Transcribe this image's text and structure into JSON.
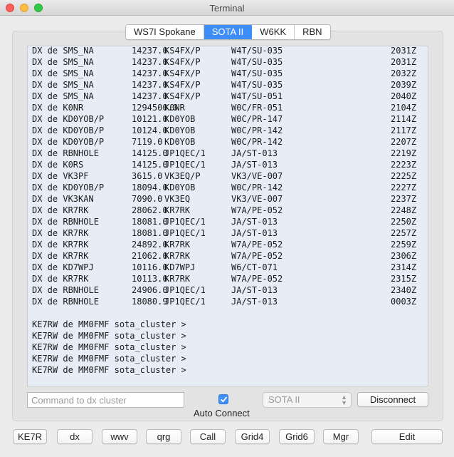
{
  "window": {
    "title": "Terminal"
  },
  "tabs": [
    {
      "label": "WS7I Spokane",
      "active": false
    },
    {
      "label": "SOTA II",
      "active": true
    },
    {
      "label": "W6KK",
      "active": false
    },
    {
      "label": "RBN",
      "active": false
    }
  ],
  "terminal": {
    "spots": [
      [
        "DX de SMS_NA",
        "14237.0",
        "KS4FX/P",
        "W4T/SU-035",
        "2031Z"
      ],
      [
        "DX de SMS_NA",
        "14237.0",
        "KS4FX/P",
        "W4T/SU-035",
        "2031Z"
      ],
      [
        "DX de SMS_NA",
        "14237.0",
        "KS4FX/P",
        "W4T/SU-035",
        "2032Z"
      ],
      [
        "DX de SMS_NA",
        "14237.0",
        "KS4FX/P",
        "W4T/SU-035",
        "2039Z"
      ],
      [
        "DX de SMS_NA",
        "14237.0",
        "KS4FX/P",
        "W4T/SU-051",
        "2040Z"
      ],
      [
        "DX de K0NR",
        "1294500.0",
        "K0NR",
        "W0C/FR-051",
        "2104Z"
      ],
      [
        "DX de KD0YOB/P",
        "10121.0",
        "KD0YOB",
        "W0C/PR-147",
        "2114Z"
      ],
      [
        "DX de KD0YOB/P",
        "10124.0",
        "KD0YOB",
        "W0C/PR-142",
        "2117Z"
      ],
      [
        "DX de KD0YOB/P",
        "7119.0",
        "KD0YOB",
        "W0C/PR-142",
        "2207Z"
      ],
      [
        "DX de RBNHOLE",
        "14125.0",
        "JP1QEC/1",
        "JA/ST-013",
        "2219Z"
      ],
      [
        "DX de K0RS",
        "14125.0",
        "JP1QEC/1",
        "JA/ST-013",
        "2223Z"
      ],
      [
        "DX de VK3PF",
        "3615.0",
        "VK3EQ/P",
        "VK3/VE-007",
        "2225Z"
      ],
      [
        "DX de KD0YOB/P",
        "18094.0",
        "KD0YOB",
        "W0C/PR-142",
        "2227Z"
      ],
      [
        "DX de VK3KAN",
        "7090.0",
        "VK3EQ",
        "VK3/VE-007",
        "2237Z"
      ],
      [
        "DX de KR7RK",
        "28062.0",
        "KR7RK",
        "W7A/PE-052",
        "2248Z"
      ],
      [
        "DX de RBNHOLE",
        "18081.0",
        "JP1QEC/1",
        "JA/ST-013",
        "2250Z"
      ],
      [
        "DX de KR7RK",
        "18081.0",
        "JP1QEC/1",
        "JA/ST-013",
        "2257Z"
      ],
      [
        "DX de KR7RK",
        "24892.0",
        "KR7RK",
        "W7A/PE-052",
        "2259Z"
      ],
      [
        "DX de KR7RK",
        "21062.0",
        "KR7RK",
        "W7A/PE-052",
        "2306Z"
      ],
      [
        "DX de KD7WPJ",
        "10116.0",
        "KD7WPJ",
        "W6/CT-071",
        "2314Z"
      ],
      [
        "DX de KR7RK",
        "10113.0",
        "KR7RK",
        "W7A/PE-052",
        "2315Z"
      ],
      [
        "DX de RBNHOLE",
        "24906.0",
        "JP1QEC/1",
        "JA/ST-013",
        "2340Z"
      ],
      [
        "DX de RBNHOLE",
        "18080.9",
        "JP1QEC/1",
        "JA/ST-013",
        "0003Z"
      ]
    ],
    "prompts": [
      "KE7RW de MM0FMF sota_cluster >",
      "KE7RW de MM0FMF sota_cluster >",
      "KE7RW de MM0FMF sota_cluster >",
      "KE7RW de MM0FMF sota_cluster >",
      "KE7RW de MM0FMF sota_cluster >"
    ]
  },
  "controls": {
    "command_placeholder": "Command to dx cluster",
    "auto_connect_label": "Auto Connect",
    "auto_connect_checked": true,
    "cluster_select": "SOTA II",
    "disconnect_label": "Disconnect"
  },
  "bottom_buttons": [
    "KE7R",
    "dx",
    "wwv",
    "qrg",
    "Call",
    "Grid4",
    "Grid6",
    "Mgr",
    "Edit"
  ],
  "colors": {
    "accent": "#3d8ef8",
    "terminal_bg": "#e7edf6"
  }
}
